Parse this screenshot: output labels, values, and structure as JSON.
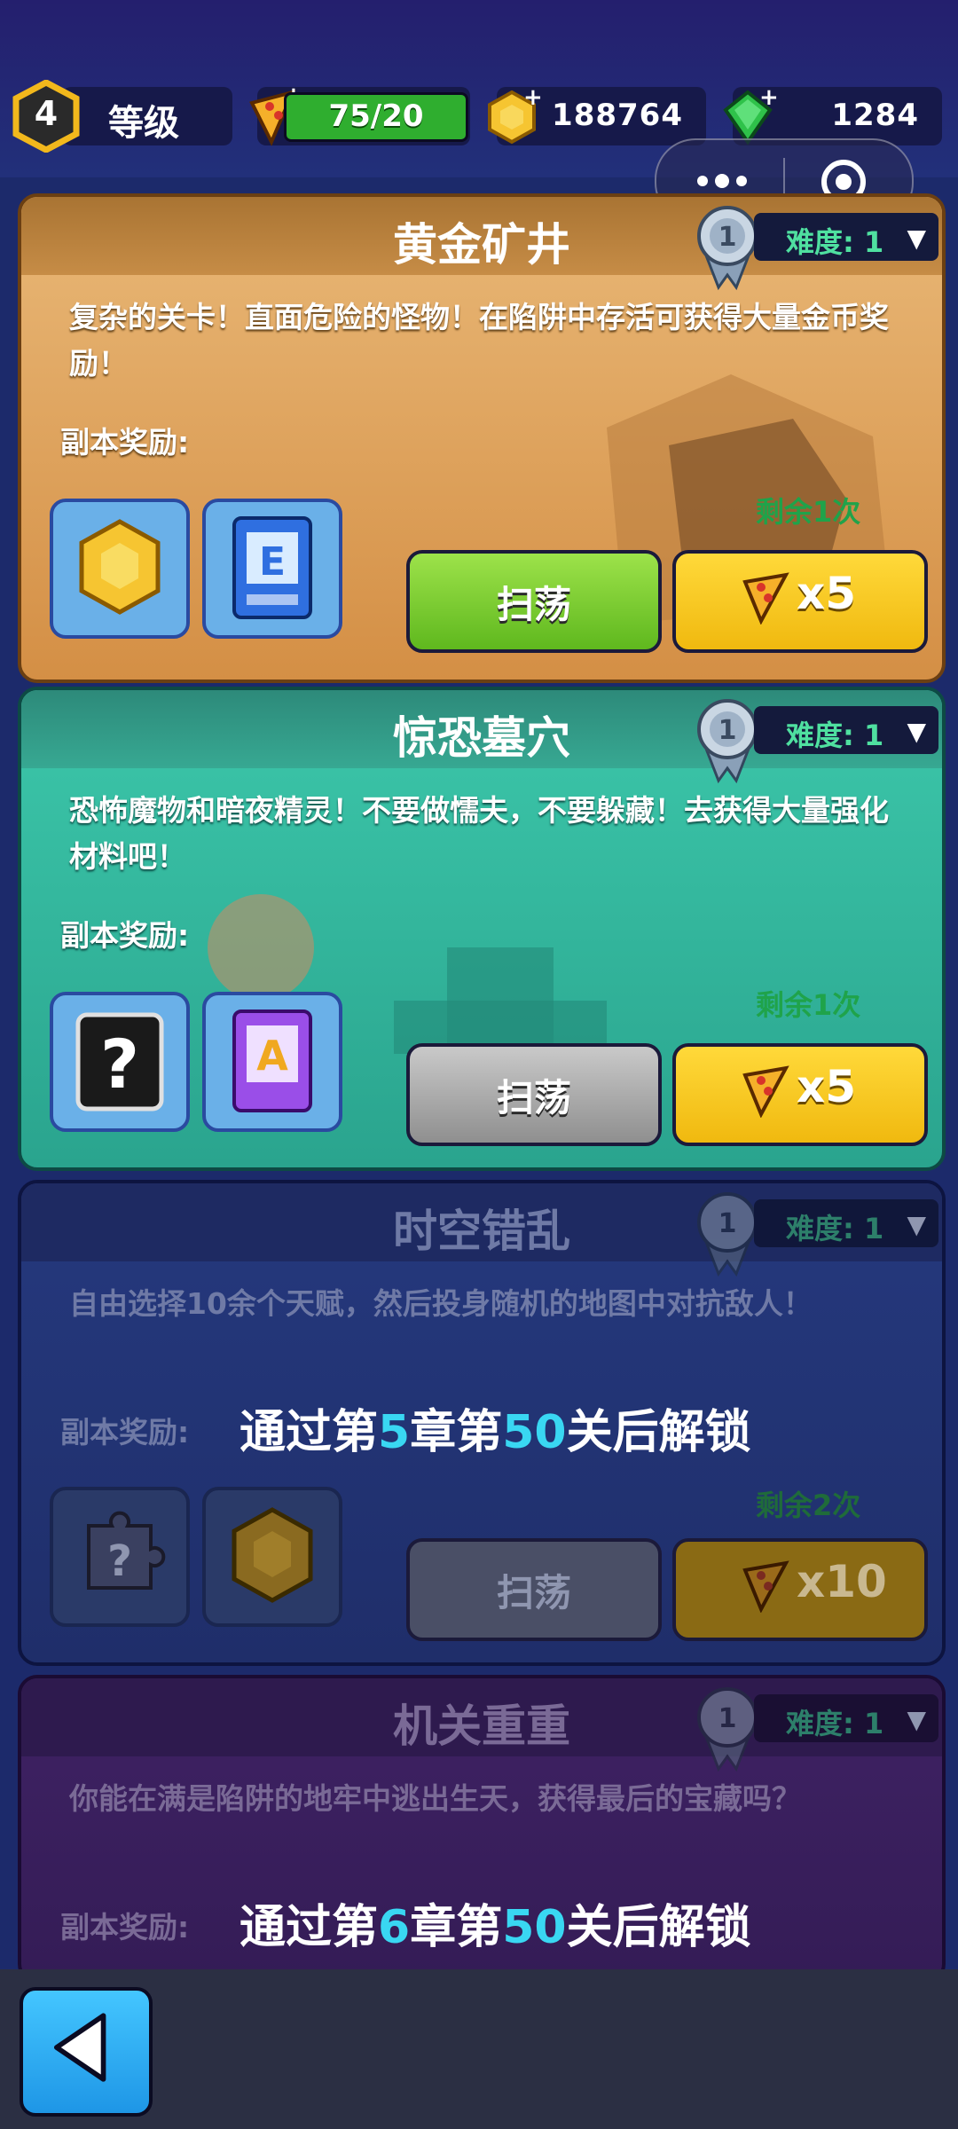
{
  "header": {
    "level_number": "4",
    "level_label": "等级",
    "energy": "75/20",
    "gold": "188764",
    "gems": "1284"
  },
  "dungeons": [
    {
      "title": "黄金矿井",
      "difficulty": "难度: 1",
      "description": "复杂的关卡！直面危险的怪物！在陷阱中存活可获得大量金币奖励！",
      "reward_label": "副本奖励:",
      "remaining": "剩余1次",
      "sweep_label": "扫荡",
      "cost": "x5",
      "locked": false
    },
    {
      "title": "惊恐墓穴",
      "difficulty": "难度: 1",
      "description": "恐怖魔物和暗夜精灵！不要做懦夫，不要躲藏！去获得大量强化材料吧！",
      "reward_label": "副本奖励:",
      "remaining": "剩余1次",
      "sweep_label": "扫荡",
      "cost": "x5",
      "locked": false
    },
    {
      "title": "时空错乱",
      "difficulty": "难度: 1",
      "description": "自由选择10余个天赋，然后投身随机的地图中对抗敌人！",
      "reward_label": "副本奖励:",
      "remaining": "剩余2次",
      "sweep_label": "扫荡",
      "cost": "x10",
      "locked": true,
      "unlock_pre": "通过第",
      "unlock_chapter": "5",
      "unlock_mid": "章第",
      "unlock_stage": "50",
      "unlock_post": "关后解锁"
    },
    {
      "title": "机关重重",
      "difficulty": "难度: 1",
      "description": "你能在满是陷阱的地牢中逃出生天，获得最后的宝藏吗？",
      "reward_label": "副本奖励:",
      "locked": true,
      "unlock_pre": "通过第",
      "unlock_chapter": "6",
      "unlock_mid": "章第",
      "unlock_stage": "50",
      "unlock_post": "关后解锁"
    }
  ],
  "colors": {
    "gold_card": "#e0a55a",
    "crypt_card": "#2fb5a0",
    "locked_card": "#23306a",
    "locked_purple": "#3a1f5a",
    "sweep_green": "#7bd12a",
    "cost_yellow": "#f5c518",
    "accent_cyan": "#39d7f2"
  }
}
